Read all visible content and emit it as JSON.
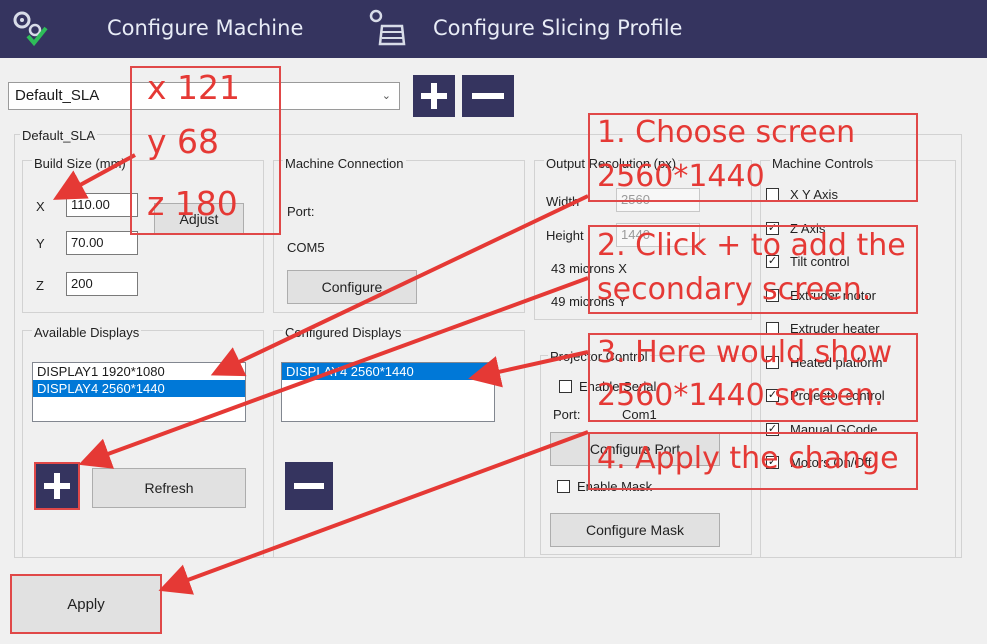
{
  "app": {
    "tab_machine": "Configure Machine",
    "tab_slicing": "Configure Slicing Profile"
  },
  "profile": {
    "selected": "Default_SLA",
    "group_title": "Default_SLA"
  },
  "build_size": {
    "title": "Build Size (mm)",
    "x_label": "X",
    "x_value": "110.00",
    "y_label": "Y",
    "y_value": "70.00",
    "z_label": "Z",
    "z_value": "200",
    "adjust_button": "Adjust"
  },
  "machine_connection": {
    "title": "Machine Connection",
    "port_label": "Port:",
    "port_value": "COM5",
    "configure_button": "Configure"
  },
  "output_resolution": {
    "title": "Output Resolution (px)",
    "width_label": "Width",
    "width_value": "2560",
    "height_label": "Height",
    "height_value": "1440",
    "microns_x": "43 microns X",
    "microns_y": "49 microns Y"
  },
  "machine_controls": {
    "title": "Machine Controls",
    "items": [
      {
        "label": "X Y Axis",
        "checked": false
      },
      {
        "label": "Z Axis",
        "checked": true
      },
      {
        "label": "Tilt control",
        "checked": true
      },
      {
        "label": "Extruder motor",
        "checked": false
      },
      {
        "label": "Extruder heater",
        "checked": false
      },
      {
        "label": "Heated platform",
        "checked": false
      },
      {
        "label": "Projector control",
        "checked": true
      },
      {
        "label": "Manual GCode",
        "checked": true
      },
      {
        "label": "Motors On/Off",
        "checked": true
      }
    ]
  },
  "available_displays": {
    "title": "Available Displays",
    "items": [
      {
        "label": "DISPLAY1 1920*1080",
        "selected": false
      },
      {
        "label": "DISPLAY4 2560*1440",
        "selected": true
      }
    ],
    "refresh_button": "Refresh"
  },
  "configured_displays": {
    "title": "Configured Displays",
    "items": [
      {
        "label": "DISPLAY4 2560*1440",
        "selected": true
      }
    ]
  },
  "projector_control": {
    "title": "Projector Control",
    "enable_serial": "Enable Serial",
    "port_label": "Port:",
    "port_value": "Com1",
    "configure_port_button": "Configure Port",
    "enable_mask": "Enable Mask",
    "configure_mask_button": "Configure Mask"
  },
  "apply_button": "Apply",
  "annotations": {
    "x_note": "x 121",
    "y_note": "y 68",
    "z_note": "z 180",
    "step1_line1": "1. Choose screen",
    "step1_line2": "2560*1440",
    "step2_line1": "2. Click + to add the",
    "step2_line2": "secondary screen.",
    "step3_line1": "3. Here would show",
    "step3_line2": "2560*1440 screen.",
    "step4": "4. Apply the change"
  },
  "colors": {
    "header_bg": "#35345f",
    "accent_blue": "#0078d7",
    "annotation_red": "#e53935"
  }
}
